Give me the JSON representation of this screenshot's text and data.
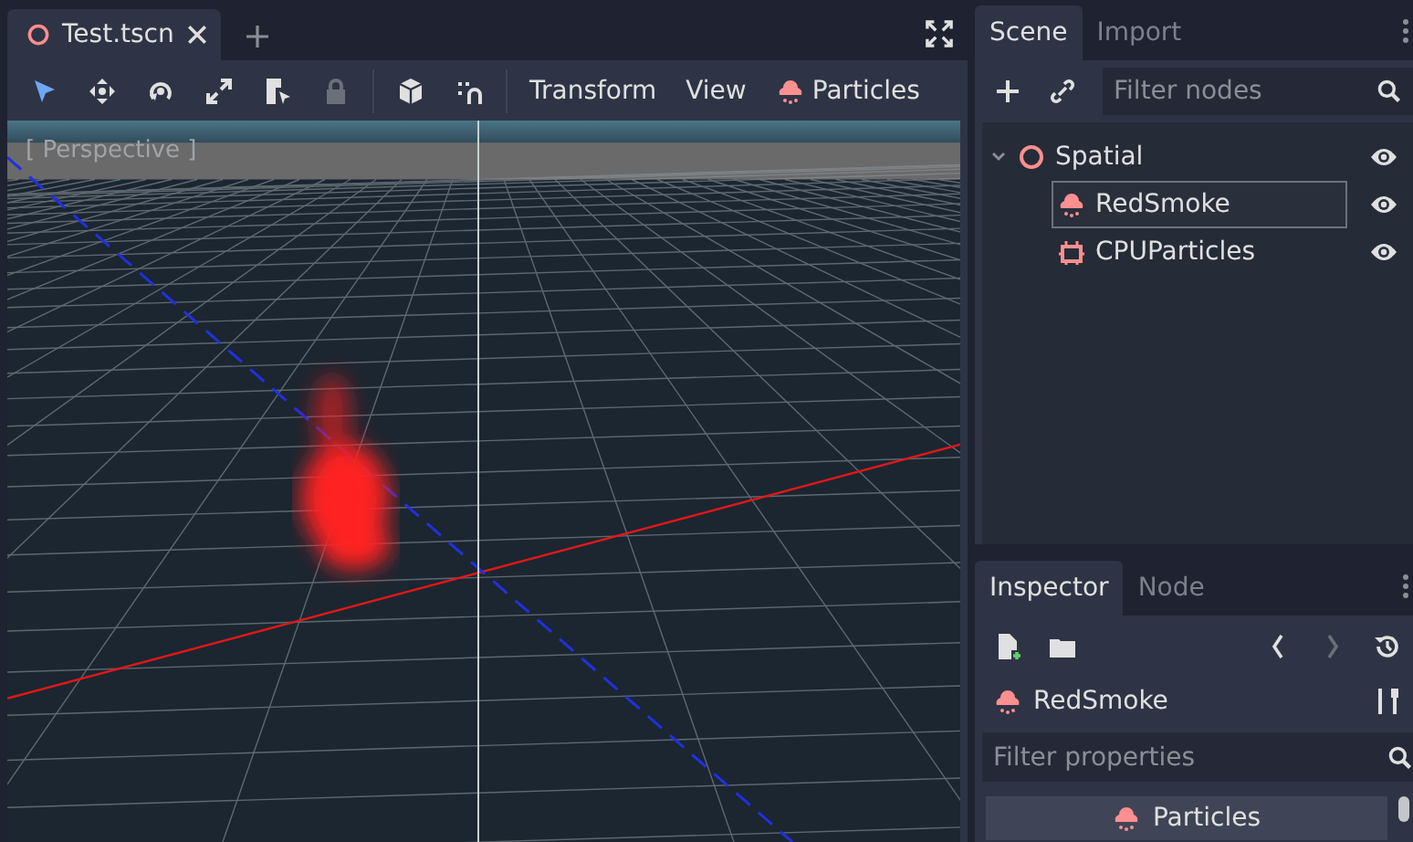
{
  "editor_tabs": [
    {
      "label": "Test.tscn",
      "selected": true
    }
  ],
  "toolbar": {
    "menus": [
      "Transform",
      "View"
    ],
    "plugin_menu": "Particles"
  },
  "viewport": {
    "label": "[ Perspective ]"
  },
  "scene_dock": {
    "tabs": [
      {
        "label": "Scene",
        "selected": true
      },
      {
        "label": "Import",
        "selected": false
      }
    ],
    "filter": {
      "placeholder": "Filter nodes"
    },
    "tree": [
      {
        "name": "Spatial",
        "kind": "spatial",
        "expanded": true,
        "selected": false,
        "children": [
          {
            "name": "RedSmoke",
            "kind": "particles",
            "selected": true
          },
          {
            "name": "CPUParticles",
            "kind": "cpuparticles",
            "selected": false
          }
        ]
      }
    ]
  },
  "inspector_dock": {
    "tabs": [
      {
        "label": "Inspector",
        "selected": true
      },
      {
        "label": "Node",
        "selected": false
      }
    ],
    "object_name": "RedSmoke",
    "filter": {
      "placeholder": "Filter properties"
    },
    "section": "Particles"
  }
}
